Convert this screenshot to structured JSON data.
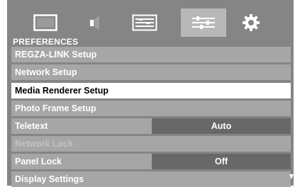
{
  "tabs": [
    {
      "icon": "picture-icon"
    },
    {
      "icon": "sound-icon"
    },
    {
      "icon": "setup-icon"
    },
    {
      "icon": "preferences-icon",
      "active": true
    },
    {
      "icon": "gear-icon"
    }
  ],
  "section_title": "PREFERENCES",
  "items": [
    {
      "label": "REGZA-LINK Setup"
    },
    {
      "label": "Network Setup"
    },
    {
      "label": "Media Renderer Setup",
      "selected": true
    },
    {
      "label": "Photo Frame Setup"
    },
    {
      "label": "Teletext",
      "value": "Auto"
    },
    {
      "label": "Network Lock",
      "disabled": true
    },
    {
      "label": "Panel Lock",
      "value": "Off"
    },
    {
      "label": "Display Settings"
    }
  ],
  "colors": {
    "panel": "#858585",
    "row": "#a6a6a6",
    "value_box": "#686868",
    "selected_row": "#ffffff",
    "active_tab": "#b8b8b8"
  }
}
